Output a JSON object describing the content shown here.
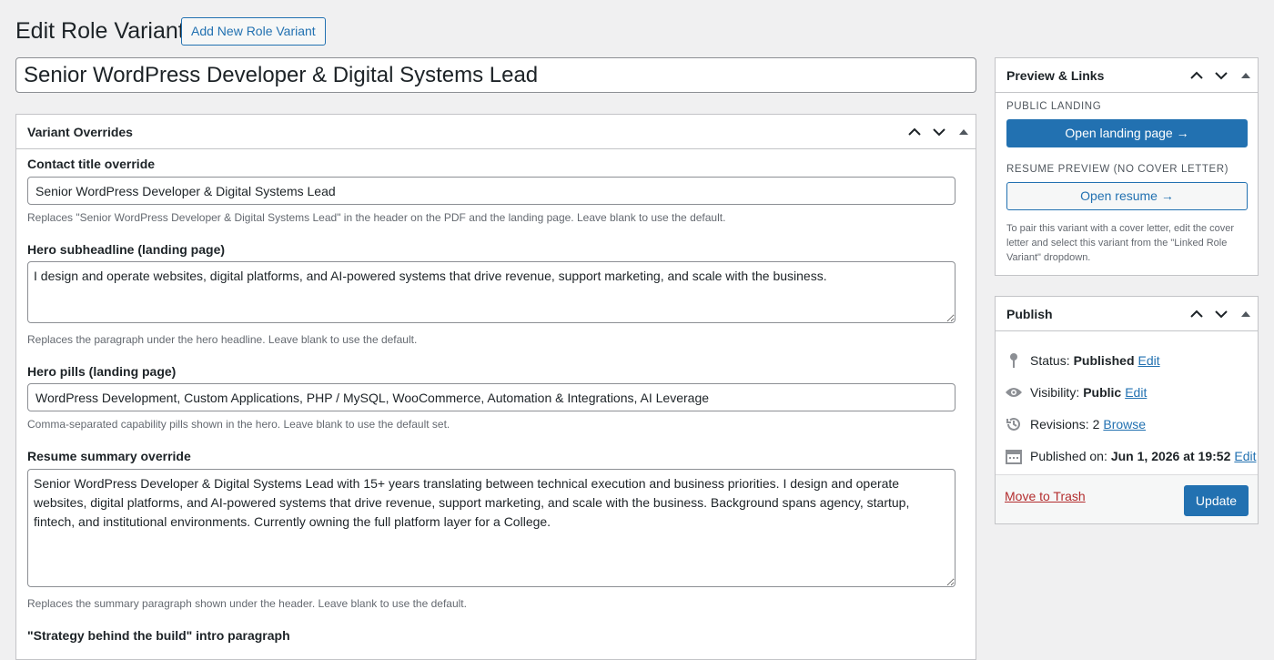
{
  "header": {
    "title": "Edit Role Variant",
    "add_new_label": "Add New Role Variant"
  },
  "post_title": {
    "value": "Senior WordPress Developer & Digital Systems Lead"
  },
  "overrides_box": {
    "title": "Variant Overrides",
    "contact_title": {
      "label": "Contact title override",
      "value": "Senior WordPress Developer & Digital Systems Lead",
      "help": "Replaces \"Senior WordPress Developer & Digital Systems Lead\" in the header on the PDF and the landing page. Leave blank to use the default."
    },
    "hero_subheadline": {
      "label": "Hero subheadline (landing page)",
      "value": "I design and operate websites, digital platforms, and AI-powered systems that drive revenue, support marketing, and scale with the business.",
      "help": "Replaces the paragraph under the hero headline. Leave blank to use the default."
    },
    "hero_pills": {
      "label": "Hero pills (landing page)",
      "value": "WordPress Development, Custom Applications, PHP / MySQL, WooCommerce, Automation & Integrations, AI Leverage",
      "help": "Comma-separated capability pills shown in the hero. Leave blank to use the default set."
    },
    "resume_summary": {
      "label": "Resume summary override",
      "value": "Senior WordPress Developer & Digital Systems Lead with 15+ years translating between technical execution and business priorities. I design and operate websites, digital platforms, and AI-powered systems that drive revenue, support marketing, and scale with the business. Background spans agency, startup, fintech, and institutional environments. Currently owning the full platform layer for a College.",
      "help": "Replaces the summary paragraph shown under the header. Leave blank to use the default."
    },
    "strategy_intro": {
      "label": "\"Strategy behind the build\" intro paragraph"
    }
  },
  "preview_box": {
    "title": "Preview & Links",
    "public_heading": "PUBLIC LANDING",
    "open_landing_label": "Open landing page →",
    "resume_heading": "RESUME PREVIEW (NO COVER LETTER)",
    "open_resume_label": "Open resume →",
    "note": "To pair this variant with a cover letter, edit the cover letter and select this variant from the \"Linked Role Variant\" dropdown."
  },
  "publish_box": {
    "title": "Publish",
    "status_label": "Status:",
    "status_value": "Published",
    "visibility_label": "Visibility:",
    "visibility_value": "Public",
    "revisions_label": "Revisions:",
    "revisions_value": "2",
    "browse_label": "Browse",
    "published_on_label": "Published on:",
    "published_on_value": "Jun 1, 2026 at 19:52",
    "edit_label": "Edit",
    "trash_label": "Move to Trash",
    "update_label": "Update"
  },
  "colors": {
    "accent": "#2271b1",
    "danger": "#b32d2e",
    "background": "#f0f0f1"
  }
}
